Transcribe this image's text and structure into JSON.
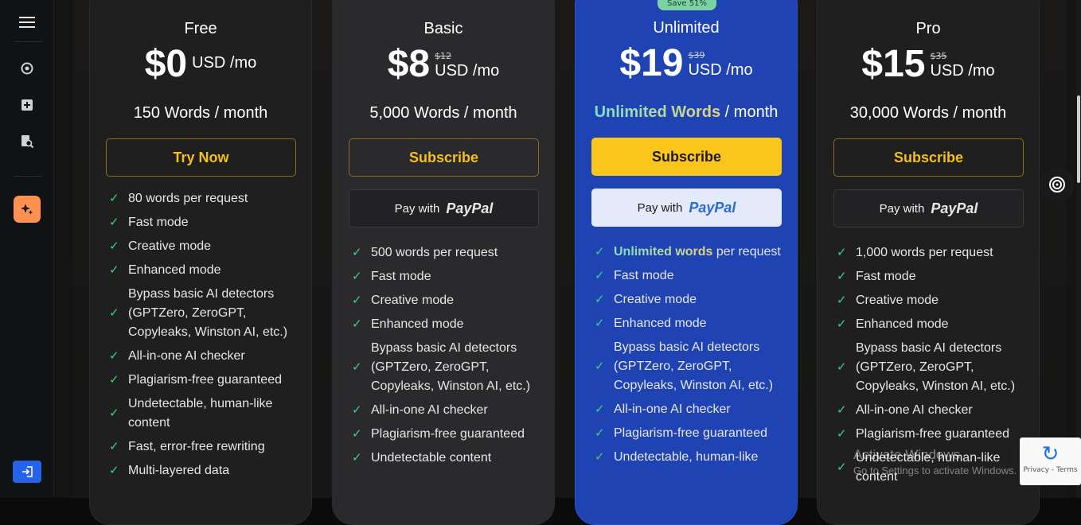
{
  "sidebar": {
    "menu_icon": "hamburger-icon",
    "items": [
      {
        "name": "refresh-icon",
        "glyph": "⟳"
      },
      {
        "name": "plus-square-icon",
        "glyph": "+"
      },
      {
        "name": "document-search-icon",
        "glyph": "⌕"
      }
    ],
    "ai_button_icon": "sparkle-icon",
    "login_icon": "login-icon"
  },
  "plans": [
    {
      "name": "Free",
      "price": "$0",
      "old_price": "",
      "period": "USD /mo",
      "words": "150 Words / month",
      "primary_label": "Try Now",
      "features": [
        "80 words per request",
        "Fast mode",
        "Creative mode",
        "Enhanced mode",
        "Bypass basic AI detectors (GPTZero, ZeroGPT, Copyleaks, Winston AI, etc.)",
        "All-in-one AI checker",
        "Plagiarism-free guaranteed",
        "Undetectable, human-like content",
        "Fast, error-free rewriting",
        "Multi-layered data"
      ]
    },
    {
      "name": "Basic",
      "price": "$8",
      "old_price": "$12",
      "period": "USD /mo",
      "words": "5,000 Words / month",
      "primary_label": "Subscribe",
      "paypal_prefix": "Pay with",
      "paypal_brand": "PayPal",
      "features": [
        "500 words per request",
        "Fast mode",
        "Creative mode",
        "Enhanced mode",
        "Bypass basic AI detectors (GPTZero, ZeroGPT, Copyleaks, Winston AI, etc.)",
        "All-in-one AI checker",
        "Plagiarism-free guaranteed",
        "Undetectable content"
      ]
    },
    {
      "name": "Unlimited",
      "price": "$19",
      "old_price": "$39",
      "period": "USD /mo",
      "words_hl": "Unlimited Words",
      "words_rest": " / month",
      "save_badge": "Save 51%",
      "primary_label": "Subscribe",
      "paypal_prefix": "Pay with",
      "paypal_brand": "PayPal",
      "feature0_hl": "Unlimited words",
      "feature0_rest": " per request",
      "features": [
        "Fast mode",
        "Creative mode",
        "Enhanced mode",
        "Bypass basic AI detectors (GPTZero, ZeroGPT, Copyleaks, Winston AI, etc.)",
        "All-in-one AI checker",
        "Plagiarism-free guaranteed",
        "Undetectable, human-like"
      ]
    },
    {
      "name": "Pro",
      "price": "$15",
      "old_price": "$35",
      "period": "USD /mo",
      "words": "30,000 Words / month",
      "primary_label": "Subscribe",
      "paypal_prefix": "Pay with",
      "paypal_brand": "PayPal",
      "features": [
        "1,000 words per request",
        "Fast mode",
        "Creative mode",
        "Enhanced mode",
        "Bypass basic AI detectors (GPTZero, ZeroGPT, Copyleaks, Winston AI, etc.)",
        "All-in-one AI checker",
        "Plagiarism-free guaranteed",
        "Undetectable, human-like content"
      ]
    }
  ],
  "overlay": {
    "watermark_line1": "Activate Windows",
    "watermark_line2": "Go to Settings to activate Windows.",
    "recaptcha_text": "Privacy - Terms"
  },
  "colors": {
    "accent_yellow": "#fcc51b",
    "unlimited_blue": "#1f43b3",
    "check_green": "#3fd37a",
    "ai_button": "#ff9250",
    "login_button": "#2563eb"
  }
}
